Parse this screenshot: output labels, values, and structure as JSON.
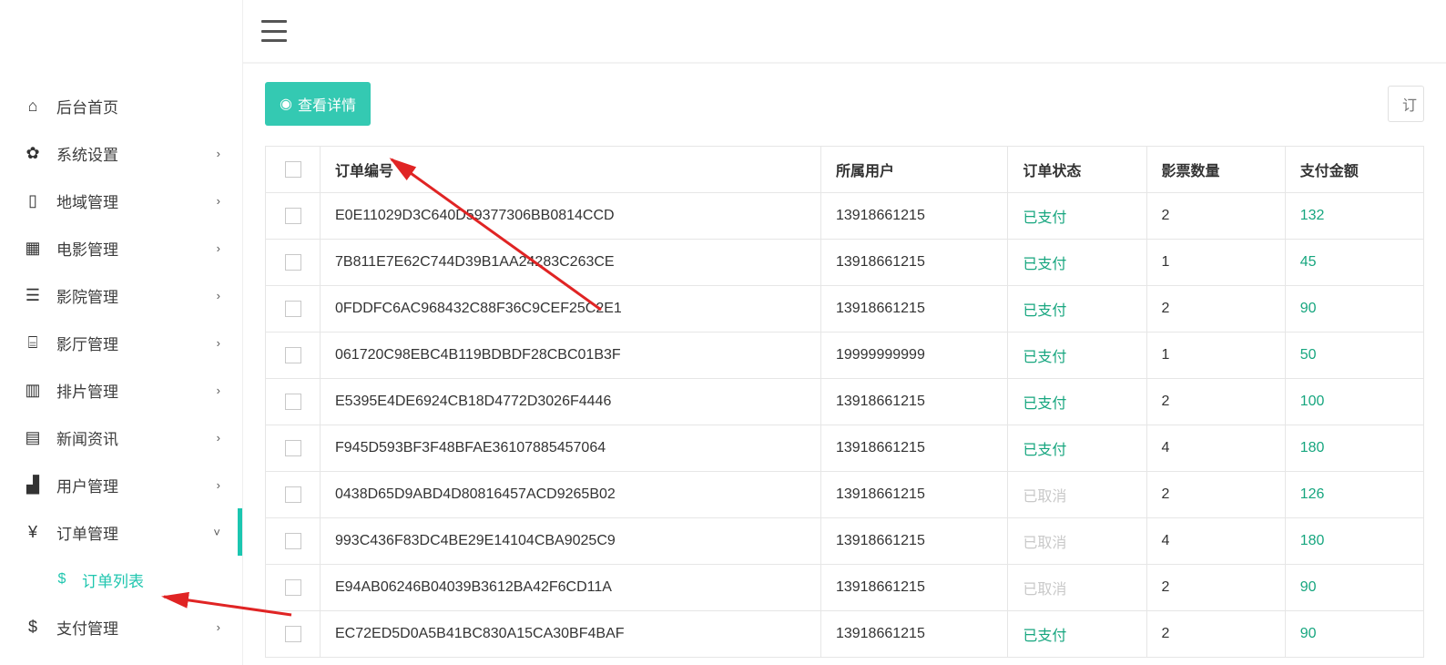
{
  "sidebar": {
    "items": [
      {
        "icon": "home-icon",
        "glyph": "⌂",
        "label": "后台首页",
        "expandable": false
      },
      {
        "icon": "gear-icon",
        "glyph": "✿",
        "label": "系统设置",
        "expandable": true
      },
      {
        "icon": "map-icon",
        "glyph": "▯",
        "label": "地域管理",
        "expandable": true
      },
      {
        "icon": "movie-icon",
        "glyph": "▦",
        "label": "电影管理",
        "expandable": true
      },
      {
        "icon": "store-icon",
        "glyph": "☰",
        "label": "影院管理",
        "expandable": true
      },
      {
        "icon": "hall-icon",
        "glyph": "⌸",
        "label": "影厅管理",
        "expandable": true
      },
      {
        "icon": "schedule-icon",
        "glyph": "▥",
        "label": "排片管理",
        "expandable": true
      },
      {
        "icon": "news-icon",
        "glyph": "▤",
        "label": "新闻资讯",
        "expandable": true
      },
      {
        "icon": "users-icon",
        "glyph": "▟",
        "label": "用户管理",
        "expandable": true
      },
      {
        "icon": "yen-icon",
        "glyph": "¥",
        "label": "订单管理",
        "expandable": true,
        "active": true,
        "children": [
          {
            "icon": "dollar-icon",
            "glyph": "$",
            "label": "订单列表"
          }
        ]
      },
      {
        "icon": "dollar-icon",
        "glyph": "$",
        "label": "支付管理",
        "expandable": true
      }
    ]
  },
  "toolbar": {
    "view_detail_label": "查看详情",
    "search_stub": "订"
  },
  "table": {
    "headers": {
      "order_no": "订单编号",
      "user": "所属用户",
      "status": "订单状态",
      "qty": "影票数量",
      "amount": "支付金额"
    },
    "status_labels": {
      "paid": "已支付",
      "cancel": "已取消"
    },
    "rows": [
      {
        "order_no": "E0E11029D3C640D59377306BB0814CCD",
        "user": "13918661215",
        "status": "paid",
        "qty": "2",
        "amount": "132"
      },
      {
        "order_no": "7B811E7E62C744D39B1AA24283C263CE",
        "user": "13918661215",
        "status": "paid",
        "qty": "1",
        "amount": "45"
      },
      {
        "order_no": "0FDDFC6AC968432C88F36C9CEF25C2E1",
        "user": "13918661215",
        "status": "paid",
        "qty": "2",
        "amount": "90"
      },
      {
        "order_no": "061720C98EBC4B119BDBDF28CBC01B3F",
        "user": "19999999999",
        "status": "paid",
        "qty": "1",
        "amount": "50"
      },
      {
        "order_no": "E5395E4DE6924CB18D4772D3026F4446",
        "user": "13918661215",
        "status": "paid",
        "qty": "2",
        "amount": "100"
      },
      {
        "order_no": "F945D593BF3F48BFAE36107885457064",
        "user": "13918661215",
        "status": "paid",
        "qty": "4",
        "amount": "180"
      },
      {
        "order_no": "0438D65D9ABD4D80816457ACD9265B02",
        "user": "13918661215",
        "status": "cancel",
        "qty": "2",
        "amount": "126"
      },
      {
        "order_no": "993C436F83DC4BE29E14104CBA9025C9",
        "user": "13918661215",
        "status": "cancel",
        "qty": "4",
        "amount": "180"
      },
      {
        "order_no": "E94AB06246B04039B3612BA42F6CD11A",
        "user": "13918661215",
        "status": "cancel",
        "qty": "2",
        "amount": "90"
      },
      {
        "order_no": "EC72ED5D0A5B41BC830A15CA30BF4BAF",
        "user": "13918661215",
        "status": "paid",
        "qty": "2",
        "amount": "90"
      }
    ]
  }
}
